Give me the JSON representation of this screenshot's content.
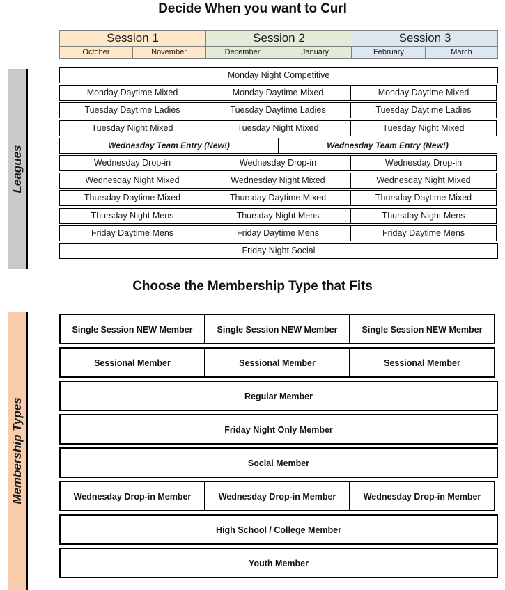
{
  "headings": {
    "leagues": "Decide When you want to Curl",
    "membership": "Choose the Membership Type that Fits"
  },
  "side_bands": {
    "leagues_label": "Leagues",
    "leagues_color": "#c9c9c9",
    "membership_label": "Membership Types",
    "membership_color": "#f9ccab"
  },
  "session_header": {
    "sessions": [
      {
        "name": "Session 1",
        "color": "#fde9c9",
        "months": [
          "October",
          "November"
        ]
      },
      {
        "name": "Session 2",
        "color": "#e1ebd8",
        "months": [
          "December",
          "January"
        ]
      },
      {
        "name": "Session 3",
        "color": "#dce7f2",
        "months": [
          "February",
          "March"
        ]
      }
    ]
  },
  "leagues": {
    "rows": [
      {
        "layout": "full",
        "cells": [
          "Monday Night Competitive"
        ],
        "italic": false
      },
      {
        "layout": "thirds",
        "cells": [
          "Monday Daytime Mixed",
          "Monday Daytime Mixed",
          "Monday Daytime Mixed"
        ],
        "italic": false
      },
      {
        "layout": "thirds",
        "cells": [
          "Tuesday Daytime Ladies",
          "Tuesday Daytime Ladies",
          "Tuesday Daytime Ladies"
        ],
        "italic": false
      },
      {
        "layout": "thirds",
        "cells": [
          "Tuesday Night Mixed",
          "Tuesday Night Mixed",
          "Tuesday Night Mixed"
        ],
        "italic": false
      },
      {
        "layout": "halves",
        "cells": [
          "Wednesday Team Entry (New!)",
          "Wednesday Team Entry (New!)"
        ],
        "italic": true
      },
      {
        "layout": "thirds",
        "cells": [
          "Wednesday Drop-in",
          "Wednesday Drop-in",
          "Wednesday Drop-in"
        ],
        "italic": false
      },
      {
        "layout": "thirds",
        "cells": [
          "Wednesday Night Mixed",
          "Wednesday Night Mixed",
          "Wednesday Night Mixed"
        ],
        "italic": false
      },
      {
        "layout": "thirds",
        "cells": [
          "Thursday Daytime Mixed",
          "Thursday Daytime Mixed",
          "Thursday Daytime Mixed"
        ],
        "italic": false
      },
      {
        "layout": "thirds",
        "cells": [
          "Thursday Night Mens",
          "Thursday Night Mens",
          "Thursday Night Mens"
        ],
        "italic": false
      },
      {
        "layout": "thirds",
        "cells": [
          "Friday Daytime Mens",
          "Friday Daytime Mens",
          "Friday Daytime Mens"
        ],
        "italic": false
      },
      {
        "layout": "full",
        "cells": [
          "Friday Night Social"
        ],
        "italic": false
      }
    ]
  },
  "membership_types": {
    "rows": [
      {
        "layout": "thirds",
        "cells": [
          "Single Session NEW Member",
          "Single Session NEW Member",
          "Single Session NEW Member"
        ]
      },
      {
        "layout": "thirds",
        "cells": [
          "Sessional Member",
          "Sessional Member",
          "Sessional Member"
        ]
      },
      {
        "layout": "full",
        "cells": [
          "Regular Member"
        ]
      },
      {
        "layout": "full",
        "cells": [
          "Friday Night Only Member"
        ]
      },
      {
        "layout": "full",
        "cells": [
          "Social Member"
        ]
      },
      {
        "layout": "thirds",
        "cells": [
          "Wednesday Drop-in Member",
          "Wednesday Drop-in Member",
          "Wednesday Drop-in Member"
        ]
      },
      {
        "layout": "full",
        "cells": [
          "High School / College Member"
        ]
      },
      {
        "layout": "full",
        "cells": [
          "Youth Member"
        ]
      }
    ]
  }
}
